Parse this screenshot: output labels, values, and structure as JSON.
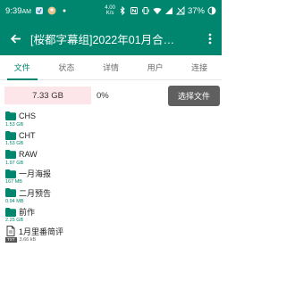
{
  "status_bar": {
    "time": "9:39",
    "am_pm": "AM",
    "network_speed_top": "4.00",
    "network_speed_bottom": "K/s",
    "battery": "37%"
  },
  "app_bar": {
    "title": "[桜都字幕组]2022年01月合…"
  },
  "tabs": [
    {
      "label": "文件"
    },
    {
      "label": "状态"
    },
    {
      "label": "详情"
    },
    {
      "label": "用户"
    },
    {
      "label": "连接"
    }
  ],
  "summary": {
    "total_size": "7.33 GB",
    "progress": "0%",
    "select_button": "选择文件"
  },
  "files": [
    {
      "name": "CHS",
      "size": "1.53 GB",
      "type": "folder"
    },
    {
      "name": "CHT",
      "size": "1.53 GB",
      "type": "folder"
    },
    {
      "name": "RAW",
      "size": "1.97 GB",
      "type": "folder"
    },
    {
      "name": "一月海报",
      "size": "167 MB",
      "type": "folder"
    },
    {
      "name": "二月预告",
      "size": "0.94 MB",
      "type": "folder"
    },
    {
      "name": "前作",
      "size": "2.25 GB",
      "type": "folder"
    },
    {
      "name": "1月里番简评",
      "size": "3.66 kB",
      "badge": "TXT",
      "type": "file"
    }
  ],
  "colors": {
    "primary": "#00866e",
    "size_box": "#fde6ea",
    "select_button": "#5f5f5f"
  }
}
